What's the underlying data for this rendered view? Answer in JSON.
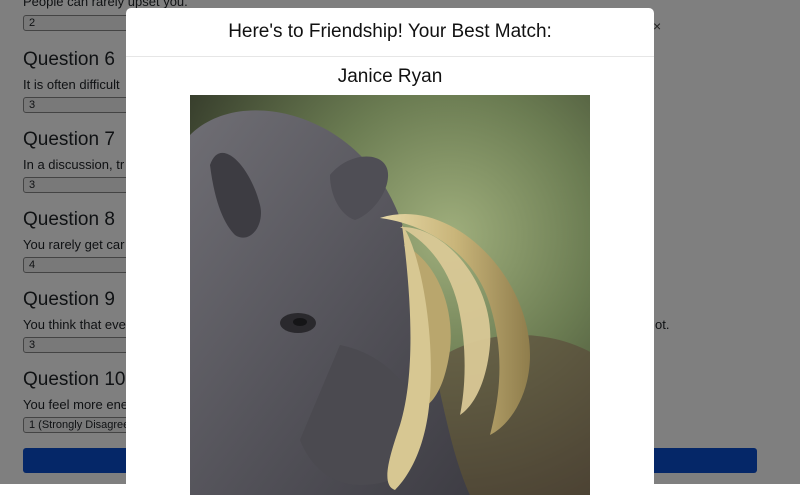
{
  "background_page": {
    "partial_top_text": "People can rarely upset you.",
    "partial_top_select": "2",
    "questions": [
      {
        "title": "Question 6",
        "text": "It is often difficult",
        "value": "3"
      },
      {
        "title": "Question 7",
        "text": "In a discussion, tr",
        "value": "3"
      },
      {
        "title": "Question 8",
        "text": "You rarely get car",
        "value": "4"
      },
      {
        "title": "Question 9",
        "text": "You think that eve",
        "value": "3"
      },
      {
        "title": "Question 10",
        "text": "You feel more ene",
        "value": "1 (Strongly Disagree"
      }
    ],
    "q9_trailing_text": "ot.",
    "close_symbol": "×"
  },
  "modal": {
    "title": "Here's to Friendship! Your Best Match:",
    "match_name": "Janice Ryan",
    "photo_description_icon": "babirusa-photo"
  },
  "colors": {
    "backdrop": "rgba(0,0,0,0.5)",
    "submit_button": "#0b4fd0",
    "modal_bg": "#ffffff"
  }
}
